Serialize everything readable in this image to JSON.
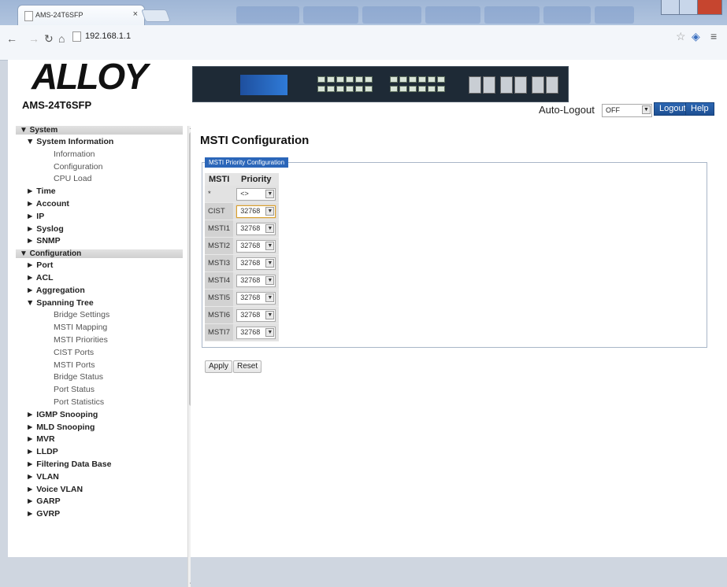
{
  "browser": {
    "tab_title": "AMS-24T6SFP",
    "tab_close": "×",
    "url": "192.168.1.1"
  },
  "header": {
    "logo_text": "ALLOY",
    "model": "AMS-24T6SFP",
    "auto_logout_label": "Auto-Logout",
    "auto_logout_value": "OFF",
    "logout_label": "Logout",
    "help_label": "Help"
  },
  "sidebar": {
    "items": [
      {
        "label": "▼ System",
        "level": "section"
      },
      {
        "label": "▼ System Information",
        "level": 1
      },
      {
        "label": "Information",
        "level": 2
      },
      {
        "label": "Configuration",
        "level": 2
      },
      {
        "label": "CPU Load",
        "level": 2
      },
      {
        "label": "► Time",
        "level": 1
      },
      {
        "label": "► Account",
        "level": 1
      },
      {
        "label": "► IP",
        "level": 1
      },
      {
        "label": "► Syslog",
        "level": 1
      },
      {
        "label": "► SNMP",
        "level": 1
      },
      {
        "label": "▼ Configuration",
        "level": "section"
      },
      {
        "label": "► Port",
        "level": 1
      },
      {
        "label": "► ACL",
        "level": 1
      },
      {
        "label": "► Aggregation",
        "level": 1
      },
      {
        "label": "▼ Spanning Tree",
        "level": 1
      },
      {
        "label": "Bridge Settings",
        "level": 2
      },
      {
        "label": "MSTI Mapping",
        "level": 2
      },
      {
        "label": "MSTI Priorities",
        "level": 2
      },
      {
        "label": "CIST Ports",
        "level": 2
      },
      {
        "label": "MSTI Ports",
        "level": 2
      },
      {
        "label": "Bridge Status",
        "level": 2
      },
      {
        "label": "Port Status",
        "level": 2
      },
      {
        "label": "Port Statistics",
        "level": 2
      },
      {
        "label": "► IGMP Snooping",
        "level": 1
      },
      {
        "label": "► MLD Snooping",
        "level": 1
      },
      {
        "label": "► MVR",
        "level": 1
      },
      {
        "label": "► LLDP",
        "level": 1
      },
      {
        "label": "► Filtering Data Base",
        "level": 1
      },
      {
        "label": "► VLAN",
        "level": 1
      },
      {
        "label": "► Voice VLAN",
        "level": 1
      },
      {
        "label": "► GARP",
        "level": 1
      },
      {
        "label": "► GVRP",
        "level": 1
      }
    ]
  },
  "main": {
    "title": "MSTI Configuration",
    "legend": "MSTI Priority Configuration",
    "columns": [
      "MSTI",
      "Priority"
    ],
    "all_row": {
      "name": "*",
      "value": "<>"
    },
    "rows": [
      {
        "name": "CIST",
        "priority": "32768"
      },
      {
        "name": "MSTI1",
        "priority": "32768"
      },
      {
        "name": "MSTI2",
        "priority": "32768"
      },
      {
        "name": "MSTI3",
        "priority": "32768"
      },
      {
        "name": "MSTI4",
        "priority": "32768"
      },
      {
        "name": "MSTI5",
        "priority": "32768"
      },
      {
        "name": "MSTI6",
        "priority": "32768"
      },
      {
        "name": "MSTI7",
        "priority": "32768"
      }
    ],
    "apply_label": "Apply",
    "reset_label": "Reset"
  },
  "colors": {
    "accent": "#2b66b9",
    "section_bg": "#d6d6d6"
  }
}
